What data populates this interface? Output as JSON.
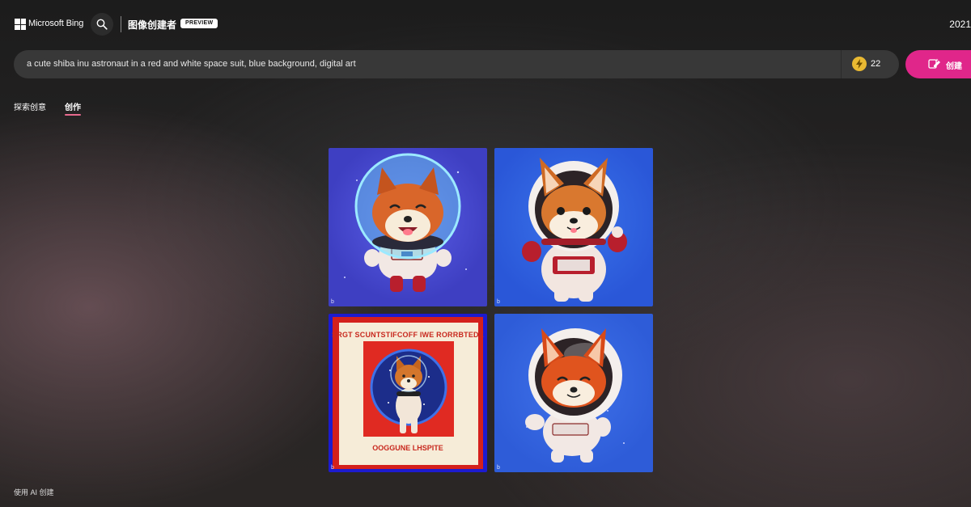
{
  "header": {
    "brand": "Microsoft Bing",
    "product": "图像创建者",
    "badge": "PREVIEW",
    "year": "2021"
  },
  "prompt": {
    "text": "a cute shiba inu astronaut in a red and white space suit, blue background, digital art",
    "boosts": "22",
    "create_label": "创建"
  },
  "tabs": [
    {
      "label": "探索创意"
    },
    {
      "label": "创作",
      "active": true
    }
  ],
  "images": [
    {
      "mark": "b"
    },
    {
      "mark": "b"
    },
    {
      "mark": "b",
      "poster_title": "SRGT SCUNTSTIFCOFF IWE RORRBTEDE",
      "poster_footer": "OOGGUNE LHSPITE"
    },
    {
      "mark": "b"
    }
  ],
  "footer": {
    "text": "使用 AI 创建"
  },
  "colors": {
    "accent": "#e0268a",
    "tab_underline": "#e86a8e",
    "boost": "#e9b932"
  }
}
